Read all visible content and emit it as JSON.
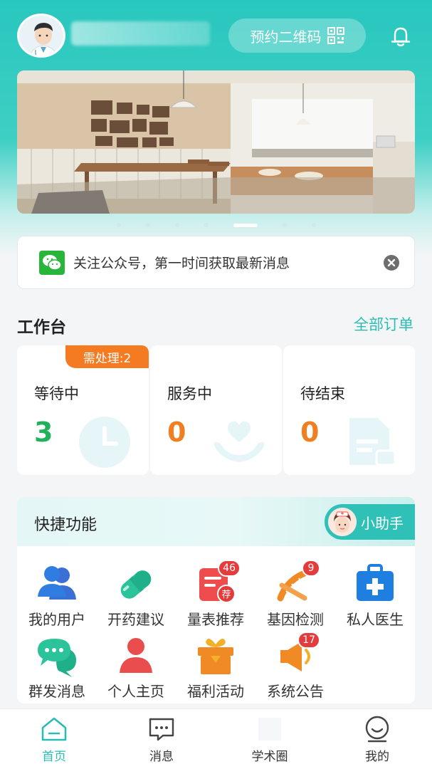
{
  "header": {
    "qr_button_label": "预约二维码"
  },
  "banner": {
    "slide_count": 7,
    "active_index": 4
  },
  "notice": {
    "text": "关注公众号，第一时间获取最新消息"
  },
  "workbench": {
    "title": "工作台",
    "all_orders_link": "全部订单",
    "cards": [
      {
        "label": "等待中",
        "value": "3",
        "color": "#20b15a",
        "tag": "需处理:2"
      },
      {
        "label": "服务中",
        "value": "0",
        "color": "#f07f22"
      },
      {
        "label": "待结束",
        "value": "0",
        "color": "#f07f22"
      }
    ]
  },
  "quick": {
    "title": "快捷功能",
    "assistant_label": "小助手",
    "items": [
      {
        "label": "我的用户",
        "icon": "users-icon"
      },
      {
        "label": "开药建议",
        "icon": "pill-icon"
      },
      {
        "label": "量表推荐",
        "icon": "form-recommend-icon",
        "badge": "46"
      },
      {
        "label": "基因检测",
        "icon": "dna-icon",
        "badge": "9"
      },
      {
        "label": "私人医生",
        "icon": "medical-kit-icon"
      },
      {
        "label": "群发消息",
        "icon": "chat-bubbles-icon"
      },
      {
        "label": "个人主页",
        "icon": "person-icon"
      },
      {
        "label": "福利活动",
        "icon": "gift-box-icon"
      },
      {
        "label": "系统公告",
        "icon": "megaphone-icon",
        "badge": "17"
      }
    ]
  },
  "tabbar": {
    "tabs": [
      {
        "label": "首页",
        "icon": "home-icon",
        "active": true
      },
      {
        "label": "消息",
        "icon": "message-icon"
      },
      {
        "label": "学术圈",
        "icon": "academic-icon"
      },
      {
        "label": "我的",
        "icon": "profile-icon"
      }
    ]
  },
  "colors": {
    "brand": "#2bbdb4",
    "warning": "#f47b22",
    "badge": "#e23c3c"
  }
}
